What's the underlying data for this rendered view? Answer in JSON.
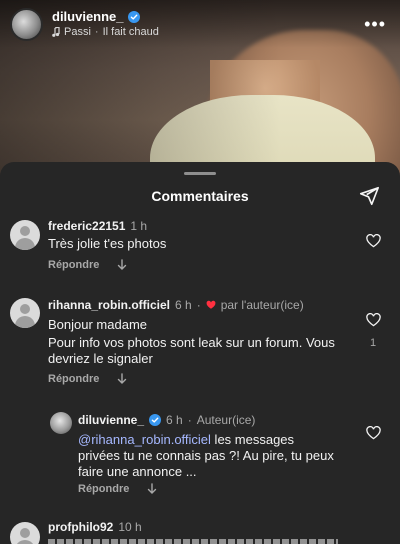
{
  "post": {
    "username": "diluvienne_",
    "music_artist": "Passi",
    "music_title": "Il fait chaud",
    "more": "•••"
  },
  "sheet": {
    "title": "Commentaires"
  },
  "comments": [
    {
      "username": "frederic22151",
      "time": "1 h",
      "text": "Très jolie t'es photos",
      "reply_label": "Répondre"
    },
    {
      "username": "rihanna_robin.officiel",
      "time": "6 h",
      "author_liked": "par l'auteur(ice)",
      "text_line1": "Bonjour madame",
      "text_line2": "Pour info vos photos sont leak sur un forum. Vous",
      "text_line3": "devriez le signaler",
      "reply_label": "Répondre",
      "likes": "1"
    },
    {
      "username": "diluvienne_",
      "time": "6 h",
      "author_tag": "Auteur(ice)",
      "mention": "@rihanna_robin.officiel",
      "text_line1": " les messages",
      "text_line2": "privées tu ne connais pas ?! Au pire, tu peux",
      "text_line3": "faire une annonce ...",
      "reply_label": "Répondre"
    },
    {
      "username": "profphilo92",
      "time": "10 h"
    }
  ],
  "colors": {
    "sheet_bg": "#262626",
    "verified": "#3897f0",
    "heart": "#ff3040",
    "mention": "#a6b8ff"
  }
}
